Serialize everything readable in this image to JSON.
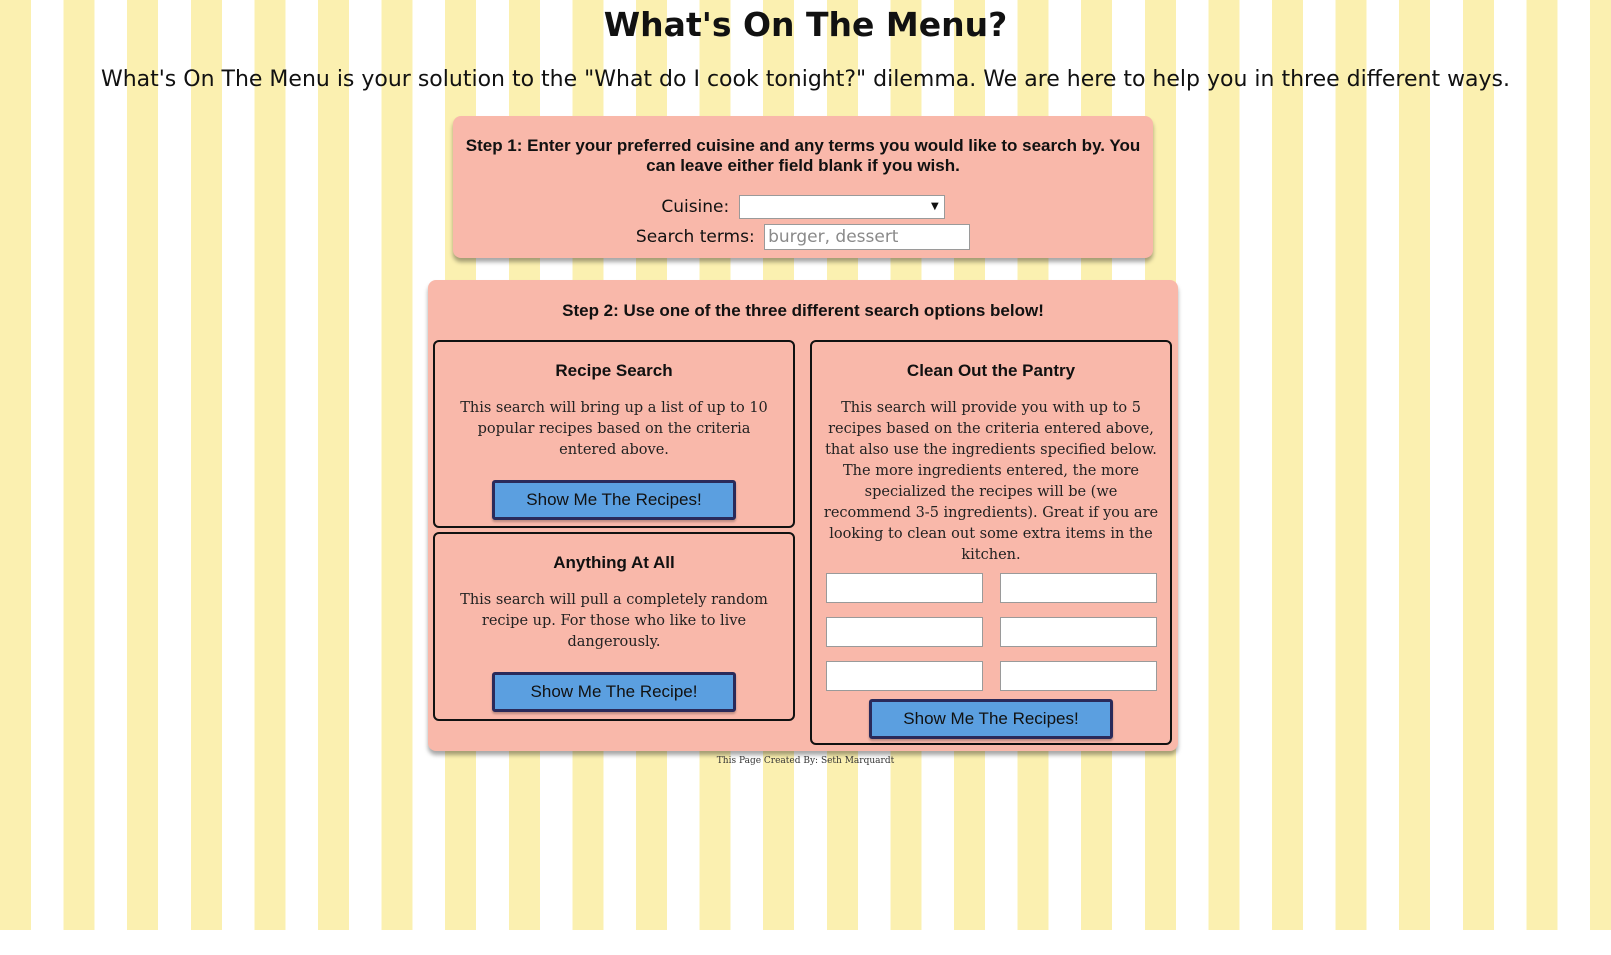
{
  "header": {
    "title": "What's On The Menu?",
    "intro": "What's On The Menu is your solution to the \"What do I cook tonight?\" dilemma. We are here to help you in three different ways."
  },
  "step1": {
    "instructions": "Step 1: Enter your preferred cuisine and any terms you would like to search by. You can leave either field blank if you wish.",
    "cuisine_label": "Cuisine:",
    "cuisine_value": "",
    "search_label": "Search terms:",
    "search_value": "",
    "search_placeholder": "burger, dessert"
  },
  "step2": {
    "instructions": "Step 2: Use one of the three different search options below!",
    "recipe_search": {
      "title": "Recipe Search",
      "description": "This search will bring up a list of up to 10 popular recipes based on the criteria entered above.",
      "button": "Show Me The Recipes!"
    },
    "anything_at_all": {
      "title": "Anything At All",
      "description": "This search will pull a completely random recipe up. For those who like to live dangerously.",
      "button": "Show Me The Recipe!"
    },
    "pantry": {
      "title": "Clean Out the Pantry",
      "description": "This search will provide you with up to 5 recipes based on the criteria entered above, that also use the ingredients specified below. The more ingredients entered, the more specialized the recipes will be (we recommend 3-5 ingredients). Great if you are looking to clean out some extra items in the kitchen.",
      "ingredients": [
        "",
        "",
        "",
        "",
        "",
        ""
      ],
      "button": "Show Me The Recipes!"
    }
  },
  "footer": {
    "credit": "This Page Created By: Seth Marquardt"
  },
  "colors": {
    "stripe_yellow": "#fbf0b0",
    "panel": "#f9b8aa",
    "button": "#5b9fe0",
    "button_border": "#2a2a5a"
  }
}
